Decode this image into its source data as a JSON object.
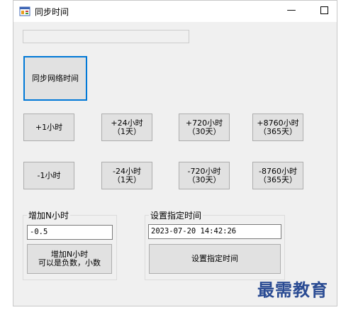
{
  "window": {
    "title": "同步时间",
    "minimize_glyph": "—"
  },
  "top_textbox": {
    "value": ""
  },
  "sync_button": {
    "label": "同步网络时间"
  },
  "add_buttons": [
    {
      "label": "+1小时"
    },
    {
      "label": "+24小时\n（1天）"
    },
    {
      "label": "+720小时\n（30天）"
    },
    {
      "label": "+8760小时\n（365天）"
    }
  ],
  "sub_buttons": [
    {
      "label": "-1小时"
    },
    {
      "label": "-24小时\n（1天）"
    },
    {
      "label": "-720小时\n（30天）"
    },
    {
      "label": "-8760小时\n（365天）"
    }
  ],
  "add_n_group": {
    "title": "增加N小时",
    "input_value": "-0.5",
    "button_label": "增加N小时\n可以是负数，小数"
  },
  "set_time_group": {
    "title": "设置指定时间",
    "input_value": "2023-07-20 14:42:26",
    "button_label": "设置指定时间"
  },
  "watermark": {
    "text": "最需教育"
  },
  "colors": {
    "accent": "#0078d7",
    "watermark": "#2a4b93",
    "window_bg": "#f0f0f0",
    "button_bg": "#e1e1e1"
  },
  "icons": {
    "app": "windows-form-icon",
    "minimize": "minimize-icon",
    "maximize": "maximize-icon"
  }
}
